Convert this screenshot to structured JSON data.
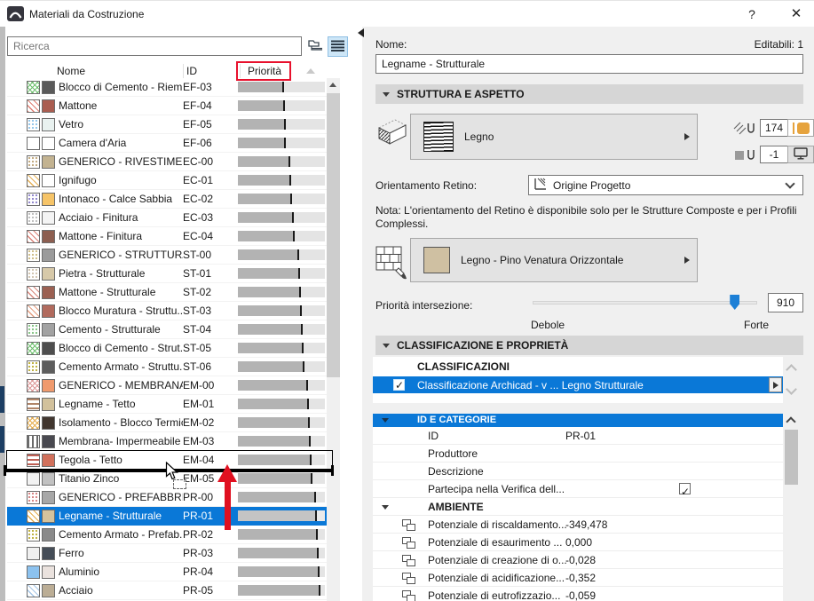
{
  "window": {
    "title": "Materiali da Costruzione",
    "help_label": "?",
    "close_label": "✕"
  },
  "search": {
    "placeholder": "Ricerca"
  },
  "list_header": {
    "name": "Nome",
    "id": "ID",
    "priority": "Priorità"
  },
  "material_list": {
    "rows": [
      {
        "name": "Blocco di Cemento - Riem...",
        "id": "EF-03",
        "priority": 0.53,
        "pattern": "crosshatch",
        "pattern_color": "#6fbf6f",
        "fill_color": "#5a5a5a"
      },
      {
        "name": "Mattone",
        "id": "EF-04",
        "priority": 0.545,
        "pattern": "diag",
        "pattern_color": "#e07f73",
        "fill_color": "#aa5d50"
      },
      {
        "name": "Vetro",
        "id": "EF-05",
        "priority": 0.55,
        "pattern": "dots",
        "pattern_color": "#8fc4ea",
        "fill_color": "#e9f2f0"
      },
      {
        "name": "Camera d'Aria",
        "id": "EF-06",
        "priority": 0.555,
        "pattern": "solid",
        "pattern_color": "#ffffff",
        "fill_color": "#ffffff"
      },
      {
        "name": "GENERICO - RIVESTIMENT...",
        "id": "EC-00",
        "priority": 0.6,
        "pattern": "dots",
        "pattern_color": "#c0a87c",
        "fill_color": "#c3b391"
      },
      {
        "name": "Ignifugo",
        "id": "EC-01",
        "priority": 0.615,
        "pattern": "diag",
        "pattern_color": "#e5b159",
        "fill_color": "#ffffff"
      },
      {
        "name": "Intonaco - Calce Sabbia",
        "id": "EC-02",
        "priority": 0.625,
        "pattern": "dots",
        "pattern_color": "#8e84cc",
        "fill_color": "#f6c468"
      },
      {
        "name": "Acciaio - Finitura",
        "id": "EC-03",
        "priority": 0.64,
        "pattern": "dots",
        "pattern_color": "#bdbdbd",
        "fill_color": "#f4f4f4"
      },
      {
        "name": "Mattone - Finitura",
        "id": "EC-04",
        "priority": 0.65,
        "pattern": "diag",
        "pattern_color": "#db8176",
        "fill_color": "#8c5e50"
      },
      {
        "name": "GENERICO - STRUTTURALE",
        "id": "ST-00",
        "priority": 0.7,
        "pattern": "dots",
        "pattern_color": "#cdbb83",
        "fill_color": "#9b9b9b"
      },
      {
        "name": "Pietra - Strutturale",
        "id": "ST-01",
        "priority": 0.71,
        "pattern": "dots",
        "pattern_color": "#cfc3ae",
        "fill_color": "#d7c9a9"
      },
      {
        "name": "Mattone - Strutturale",
        "id": "ST-02",
        "priority": 0.72,
        "pattern": "diag",
        "pattern_color": "#d8897e",
        "fill_color": "#9b6052"
      },
      {
        "name": "Blocco Muratura - Struttu...",
        "id": "ST-03",
        "priority": 0.735,
        "pattern": "diag",
        "pattern_color": "#e59f82",
        "fill_color": "#b16a5d"
      },
      {
        "name": "Cemento - Strutturale",
        "id": "ST-04",
        "priority": 0.745,
        "pattern": "dots",
        "pattern_color": "#83c383",
        "fill_color": "#a2a2a2"
      },
      {
        "name": "Blocco di Cemento - Strut...",
        "id": "ST-05",
        "priority": 0.755,
        "pattern": "crosshatch",
        "pattern_color": "#6fbf6f",
        "fill_color": "#4e4e4e"
      },
      {
        "name": "Cemento Armato - Struttu...",
        "id": "ST-06",
        "priority": 0.765,
        "pattern": "dots",
        "pattern_color": "#bcae39",
        "fill_color": "#5d5d5d"
      },
      {
        "name": "GENERICO - MEMBRANA ...",
        "id": "EM-00",
        "priority": 0.81,
        "pattern": "crosshatch",
        "pattern_color": "#dd9898",
        "fill_color": "#f09a6d"
      },
      {
        "name": "Legname - Tetto",
        "id": "EM-01",
        "priority": 0.815,
        "pattern": "hstripes",
        "pattern_color": "#b08468",
        "fill_color": "#d2c19c"
      },
      {
        "name": "Isolamento - Blocco Termico",
        "id": "EM-02",
        "priority": 0.825,
        "pattern": "crosshatch",
        "pattern_color": "#e5ad4e",
        "fill_color": "#41362f"
      },
      {
        "name": "Membrana- Impermeabile",
        "id": "EM-03",
        "priority": 0.835,
        "pattern": "vstripes",
        "pattern_color": "#6a6a6a",
        "fill_color": "#494950"
      },
      {
        "name": "Tegola - Tetto",
        "id": "EM-04",
        "priority": 0.845,
        "pattern": "hstripes",
        "pattern_color": "#c06055",
        "fill_color": "#d1705b",
        "marquee": true
      },
      {
        "name": "Titanio Zinco",
        "id": "EM-05",
        "priority": 0.855,
        "pattern": "solid",
        "pattern_color": "#f2f2f2",
        "fill_color": "#c1c1c1"
      },
      {
        "name": "GENERICO - PREFABBRICA...",
        "id": "PR-00",
        "priority": 0.9,
        "pattern": "dots",
        "pattern_color": "#d47f7f",
        "fill_color": "#a7a7a7"
      },
      {
        "name": "Legname - Strutturale",
        "id": "PR-01",
        "priority": 0.91,
        "pattern": "diag",
        "pattern_color": "#e5ad4e",
        "fill_color": "#d5c39d",
        "selected": true
      },
      {
        "name": "Cemento Armato - Prefab...",
        "id": "PR-02",
        "priority": 0.92,
        "pattern": "dots",
        "pattern_color": "#bcae39",
        "fill_color": "#8a8a8a"
      },
      {
        "name": "Ferro",
        "id": "PR-03",
        "priority": 0.93,
        "pattern": "solid",
        "pattern_color": "#f0f0f0",
        "fill_color": "#454d57"
      },
      {
        "name": "Aluminio",
        "id": "PR-04",
        "priority": 0.94,
        "pattern": "solid",
        "pattern_color": "#8cc2ef",
        "fill_color": "#eae2de"
      },
      {
        "name": "Acciaio",
        "id": "PR-05",
        "priority": 0.95,
        "pattern": "diag",
        "pattern_color": "#a5c6e6",
        "fill_color": "#bbad95"
      }
    ]
  },
  "details": {
    "name_label": "Nome:",
    "editable_label": "Editabili: 1",
    "name_value": "Legname - Strutturale",
    "structure_section": "STRUTTURA E ASPETTO",
    "cut_fill_label": "Legno",
    "fill_pen_value": "174",
    "background_pen_value": "-1",
    "orientation_label": "Orientamento Retino:",
    "orientation_value": "Origine Progetto",
    "note": "Nota: L'orientamento del Retino è disponibile solo per le Strutture Composte e per i Profili Complessi.",
    "surface_label": "Legno - Pino Venatura Orizzontale",
    "surface_color": "#cfc0a2",
    "priority_label": "Priorità intersezione:",
    "priority_value": "910",
    "slider_fraction": 0.91,
    "weak_label": "Debole",
    "strong_label": "Forte",
    "classification_section": "CLASSIFICAZIONE E PROPRIETÀ",
    "classifications_header": "CLASSIFICAZIONI",
    "classification_row": "Classificazione Archicad - v ... Legno Strutturale",
    "properties_header": "ID E CATEGORIE",
    "properties": [
      {
        "type": "prop",
        "label": "ID",
        "value": "PR-01"
      },
      {
        "type": "prop",
        "label": "Produttore",
        "value": ""
      },
      {
        "type": "prop",
        "label": "Descrizione",
        "value": ""
      },
      {
        "type": "check",
        "label": "Partecipa nella Verifica dell...",
        "checked": true
      },
      {
        "type": "group",
        "label": "AMBIENTE"
      },
      {
        "type": "linked",
        "label": "Potenziale di riscaldamento...",
        "value": "-349,478"
      },
      {
        "type": "linked",
        "label": "Potenziale di esaurimento ...",
        "value": "0,000"
      },
      {
        "type": "linked",
        "label": "Potenziale di creazione di o...",
        "value": "-0,028"
      },
      {
        "type": "linked",
        "label": "Potenziale di acidificazione...",
        "value": "-0,352"
      },
      {
        "type": "linked",
        "label": "Potenziale di eutrofizzazio...",
        "value": "-0,059"
      }
    ]
  },
  "colors": {
    "accent_blue": "#0a78d7",
    "annotation_red": "#e8112d",
    "swatch_orange": "#e6a33d"
  }
}
